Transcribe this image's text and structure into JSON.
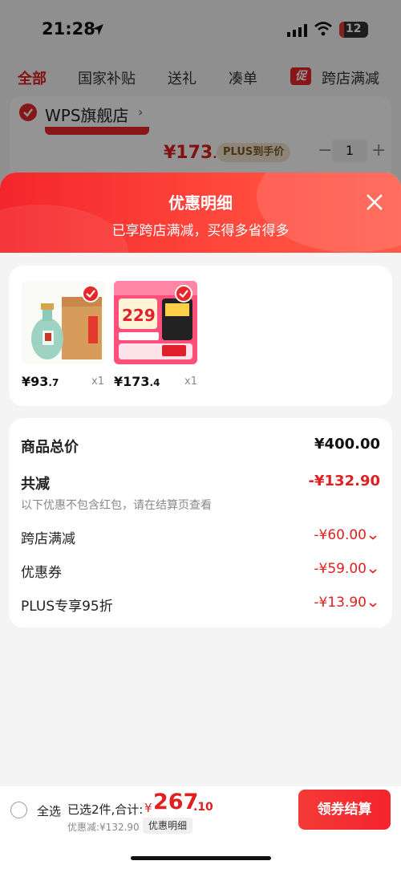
{
  "status_bar": {
    "time": "21:28",
    "battery": "12"
  },
  "tabs": [
    {
      "label": "全部",
      "active": true
    },
    {
      "label": "国家补贴"
    },
    {
      "label": "送礼"
    },
    {
      "label": "凑单"
    },
    {
      "label": "跨店满减",
      "badge": "促"
    }
  ],
  "store": {
    "name": "WPS旗舰店"
  },
  "background_item": {
    "price_main": "¥173",
    "price_cents": ".4",
    "plus_label": "PLUS到手价",
    "quantity": "1"
  },
  "sheet": {
    "title": "优惠明细",
    "subtitle": "已享跨店满减，买得多省得多"
  },
  "products": [
    {
      "price_main": "¥93",
      "price_cents": ".7",
      "qty": "x1",
      "image": "baijiu-bottle-gift-box"
    },
    {
      "price_main": "¥173",
      "price_cents": ".4",
      "qty": "x1",
      "image": "wps-membership-promo"
    }
  ],
  "summary": {
    "total_label": "商品总价",
    "total_value": "¥400.00",
    "reduce_label": "共减",
    "reduce_value": "-¥132.90",
    "note": "以下优惠不包含红包，请在结算页查看",
    "items": [
      {
        "label": "跨店满减",
        "value": "-¥60.00"
      },
      {
        "label": "优惠券",
        "value": "-¥59.00"
      },
      {
        "label": "PLUS专享95折",
        "value": "-¥13.90"
      }
    ]
  },
  "bottom_bar": {
    "select_all": "全选",
    "selected_count": "已选2件,合计:",
    "currency": "¥",
    "total_main": "267",
    "total_cents": ".10",
    "discount_text": "优惠减:¥132.90",
    "detail_label": "优惠明细",
    "checkout_label": "领券结算"
  },
  "colors": {
    "accent": "#e8262b",
    "header_gradient_start": "#f4262b",
    "header_gradient_end": "#ff5a48"
  }
}
